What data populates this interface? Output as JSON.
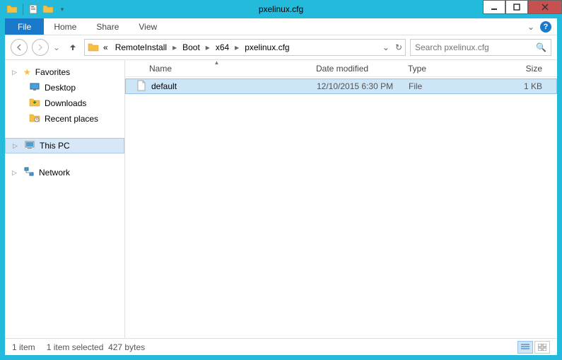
{
  "title": "pxelinux.cfg",
  "ribbon": {
    "file": "File",
    "tabs": [
      "Home",
      "Share",
      "View"
    ]
  },
  "breadcrumb": {
    "lead": "«",
    "parts": [
      "RemoteInstall",
      "Boot",
      "x64",
      "pxelinux.cfg"
    ]
  },
  "search": {
    "placeholder": "Search pxelinux.cfg"
  },
  "nav": {
    "favorites": {
      "label": "Favorites",
      "items": [
        "Desktop",
        "Downloads",
        "Recent places"
      ]
    },
    "thispc": {
      "label": "This PC"
    },
    "network": {
      "label": "Network"
    }
  },
  "columns": {
    "name": "Name",
    "date": "Date modified",
    "type": "Type",
    "size": "Size"
  },
  "files": [
    {
      "name": "default",
      "date": "12/10/2015 6:30 PM",
      "type": "File",
      "size": "1 KB"
    }
  ],
  "status": {
    "count": "1 item",
    "selected": "1 item selected",
    "bytes": "427 bytes"
  }
}
